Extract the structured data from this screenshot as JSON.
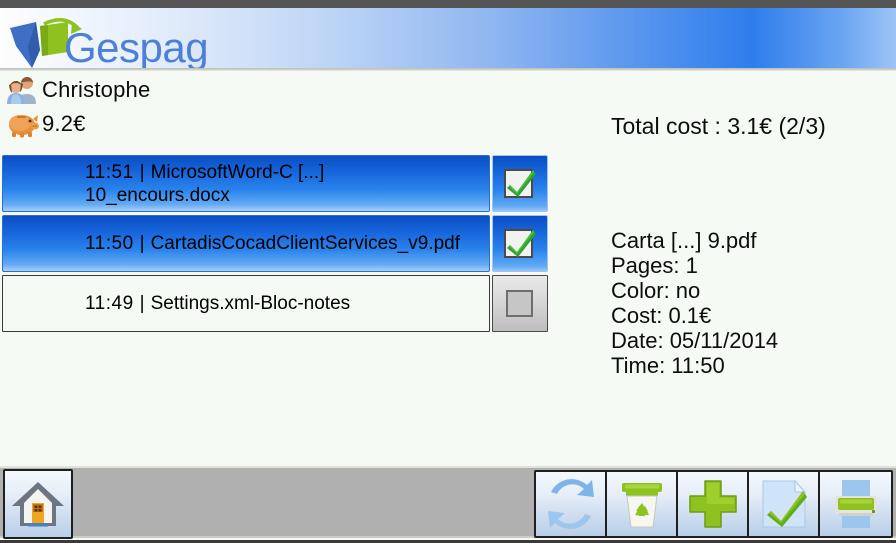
{
  "header": {
    "logo_text": "Gespage",
    "logo_icon": "gespage-logo-icon"
  },
  "account": {
    "user_icon": "users-icon",
    "user_name": "Christophe",
    "balance_icon": "piggy-bank-icon",
    "balance": "9.2€"
  },
  "summary": {
    "total_cost": "Total cost : 3.1€ (2/3)"
  },
  "job_list": [
    {
      "time": "11:51",
      "separator": "|",
      "name": "MicrosoftWord-C [...]",
      "name_line2": "10_encours.docx",
      "selected": true,
      "checkbox_icon": "checked-checkbox-icon"
    },
    {
      "time": "11:50",
      "separator": "|",
      "name": "CartadisCocadClientServices_v9.pdf",
      "name_line2": "",
      "selected": true,
      "checkbox_icon": "checked-checkbox-icon"
    },
    {
      "time": "11:49",
      "separator": "|",
      "name": "Settings.xml-Bloc-notes",
      "name_line2": "",
      "selected": false,
      "checkbox_icon": "unchecked-checkbox-icon"
    }
  ],
  "job_detail": {
    "file_name": "Carta [...] 9.pdf",
    "pages": "Pages: 1",
    "color": "Color: no",
    "cost": "Cost: 0.1€",
    "date": "Date: 05/11/2014",
    "time": "Time: 11:50"
  },
  "toolbar": {
    "home": {
      "icon": "home-icon"
    },
    "actions": [
      {
        "icon": "refresh-icon"
      },
      {
        "icon": "trash-recycle-icon"
      },
      {
        "icon": "plus-icon"
      },
      {
        "icon": "document-check-icon"
      },
      {
        "icon": "printer-icon"
      }
    ]
  },
  "colors": {
    "accent_blue": "#2f7ded",
    "selected_row": "#1766dc",
    "toolbar_bg": "#b0b0b0",
    "content_bg": "#f5faf5",
    "green": "#7fc31c"
  }
}
